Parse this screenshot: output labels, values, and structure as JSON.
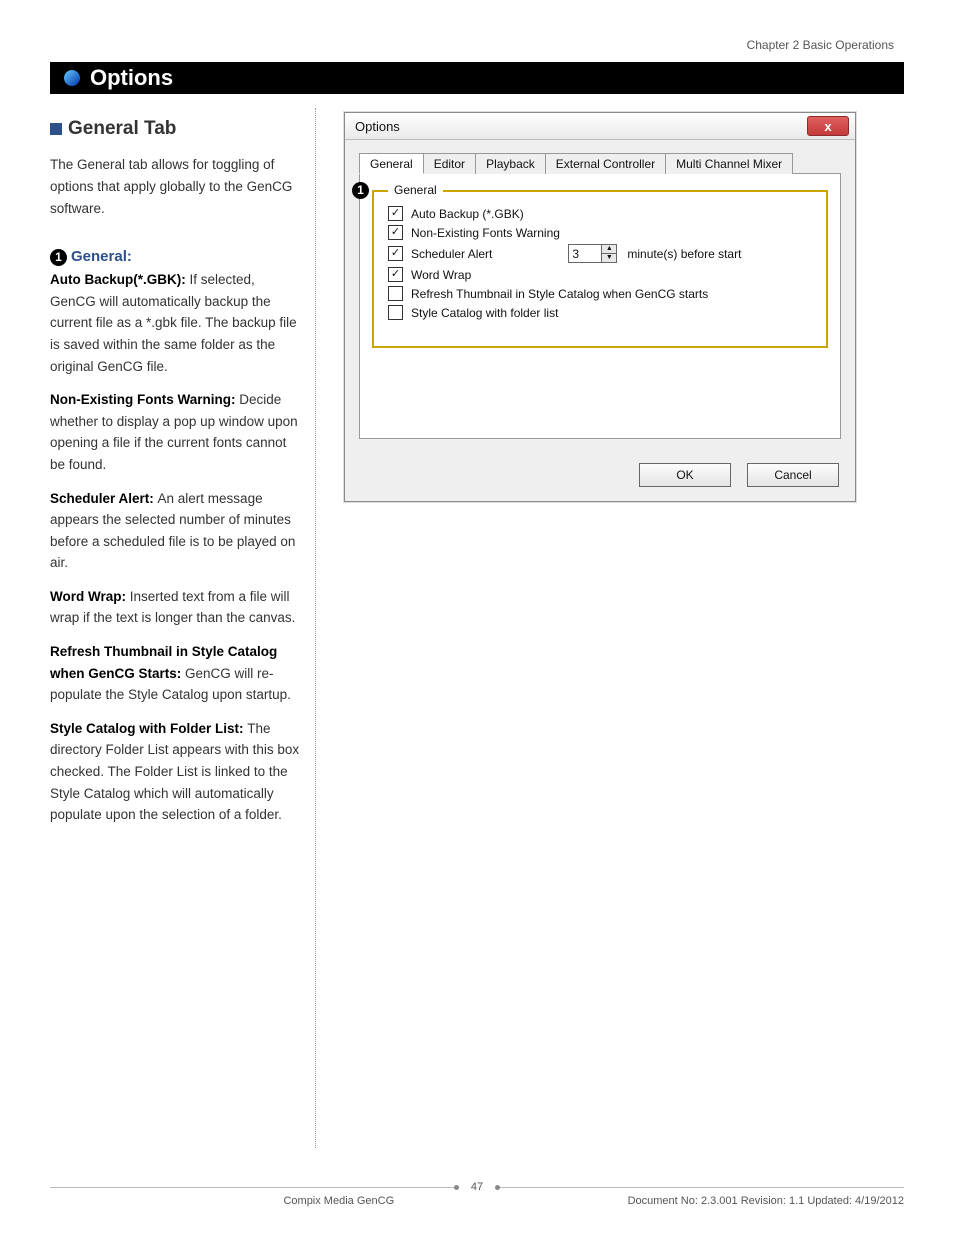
{
  "header": {
    "chapter": "Chapter 2 Basic Operations",
    "section_title": "Options"
  },
  "left": {
    "h2": "General Tab",
    "intro": "The General tab allows for toggling of options that apply globally to the GenCG software.",
    "bullet_num": "1",
    "h3": "General:",
    "items": [
      {
        "label": "Auto Backup(*.GBK): ",
        "text": "If selected, GenCG will automatically backup the current file as a *.gbk file. The backup file is saved within the same folder as the original GenCG file."
      },
      {
        "label": "Non-Existing Fonts Warning: ",
        "text": "Decide whether to display a pop up window upon opening a file if the current fonts cannot be found."
      },
      {
        "label": "Scheduler Alert: ",
        "text": "An alert message appears the selected number of minutes before a scheduled file is to be played on air."
      },
      {
        "label": "Word Wrap: ",
        "text": "Inserted text from a file will wrap if the text is longer than the canvas."
      },
      {
        "label": "Refresh Thumbnail in Style Catalog when GenCG Starts: ",
        "text": "GenCG will re-populate the Style Catalog upon startup."
      },
      {
        "label": "Style Catalog with Folder List: ",
        "text": "The directory Folder List appears with this box checked. The Folder List is linked to the Style Catalog which will automatically populate upon the selection of a folder."
      }
    ]
  },
  "dialog": {
    "title": "Options",
    "close_glyph": "x",
    "tabs": [
      "General",
      "Editor",
      "Playback",
      "External Controller",
      "Multi Channel Mixer"
    ],
    "legend": "General",
    "callout_num": "1",
    "checks": {
      "auto_backup": {
        "label": "Auto Backup (*.GBK)",
        "checked": true
      },
      "fonts_warn": {
        "label": "Non-Existing Fonts Warning",
        "checked": true
      },
      "sched_alert": {
        "label": "Scheduler Alert",
        "checked": true,
        "value": "3",
        "suffix": "minute(s) before start"
      },
      "word_wrap": {
        "label": "Word Wrap",
        "checked": true
      },
      "refresh_thumb": {
        "label": "Refresh Thumbnail in Style Catalog when GenCG starts",
        "checked": false
      },
      "style_folder": {
        "label": "Style Catalog with folder list",
        "checked": false
      }
    },
    "ok": "OK",
    "cancel": "Cancel"
  },
  "footer": {
    "page": "47",
    "product": "Compix Media GenCG",
    "docinfo": "Document No: 2.3.001 Revision: 1.1 Updated: 4/19/2012"
  }
}
